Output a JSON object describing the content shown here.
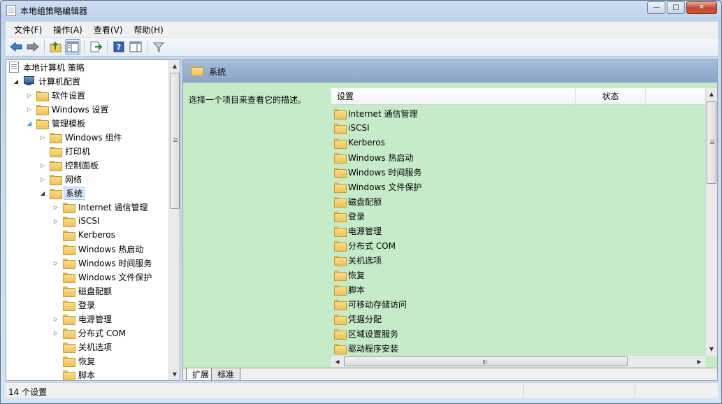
{
  "window": {
    "title": "本地组策略编辑器",
    "minimize_glyph": "—",
    "maximize_glyph": "□",
    "close_glyph": "✕"
  },
  "menu": [
    "文件(F)",
    "操作(A)",
    "查看(V)",
    "帮助(H)"
  ],
  "toolbar": {
    "icons": [
      "back-arrow-icon",
      "forward-arrow-icon",
      "up-folder-icon",
      "show-hide-tree-icon",
      "export-list-icon",
      "help-icon",
      "show-action-pane-icon",
      "filter-icon"
    ]
  },
  "tree": {
    "root": "本地计算机 策略",
    "computer_config": "计算机配置",
    "software_settings": "软件设置",
    "windows_settings": "Windows 设置",
    "admin_templates": "管理模板",
    "windows_components": "Windows 组件",
    "printers": "打印机",
    "control_panel": "控制面板",
    "network": "网络",
    "system": "系统",
    "system_children": [
      "Internet 通信管理",
      "iSCSI",
      "Kerberos",
      "Windows 热启动",
      "Windows 时间服务",
      "Windows 文件保护",
      "磁盘配额",
      "登录",
      "电源管理",
      "分布式 COM",
      "关机选项",
      "恢复",
      "脚本"
    ]
  },
  "right": {
    "header_title": "系统",
    "description": "选择一个项目来查看它的描述。",
    "columns": {
      "setting": "设置",
      "state": "状态"
    },
    "items": [
      "Internet 通信管理",
      "iSCSI",
      "Kerberos",
      "Windows 热启动",
      "Windows 时间服务",
      "Windows 文件保护",
      "磁盘配额",
      "登录",
      "电源管理",
      "分布式 COM",
      "关机选项",
      "恢复",
      "脚本",
      "可移动存储访问",
      "凭据分配",
      "区域设置服务",
      "驱动程序安装"
    ]
  },
  "tabs": {
    "extended": "扩展",
    "standard": "标准"
  },
  "status": {
    "text": "14 个设置"
  },
  "scroll_glyphs": {
    "up": "▲",
    "down": "▼",
    "left": "◀",
    "right": "▶"
  }
}
